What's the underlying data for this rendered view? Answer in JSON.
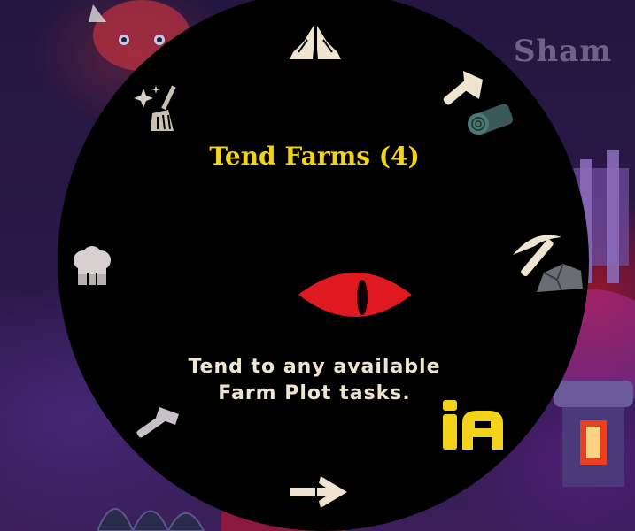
{
  "task_wheel": {
    "selected_title": "Tend Farms (4)",
    "selected_description_line1": "Tend to any available",
    "selected_description_line2": "Farm Plot tasks.",
    "options": [
      {
        "name": "worship",
        "icon": "praying-hands-icon"
      },
      {
        "name": "chop-wood",
        "icon": "axe-log-icon"
      },
      {
        "name": "mine-stone",
        "icon": "pickaxe-stone-icon"
      },
      {
        "name": "farm",
        "icon": "farm-icon"
      },
      {
        "name": "move",
        "icon": "arrow-right-icon"
      },
      {
        "name": "build",
        "icon": "hammer-icon"
      },
      {
        "name": "cook",
        "icon": "chef-hat-icon"
      },
      {
        "name": "clean",
        "icon": "broom-sparkle-icon"
      }
    ],
    "center_icon": "red-eye-icon"
  },
  "background": {
    "name_text": "Sham"
  },
  "colors": {
    "title": "#f2d21a",
    "description": "#efe4d0",
    "icon": "#efe4d0",
    "selected_icon": "#f2d21a",
    "eye": "#e01820"
  }
}
